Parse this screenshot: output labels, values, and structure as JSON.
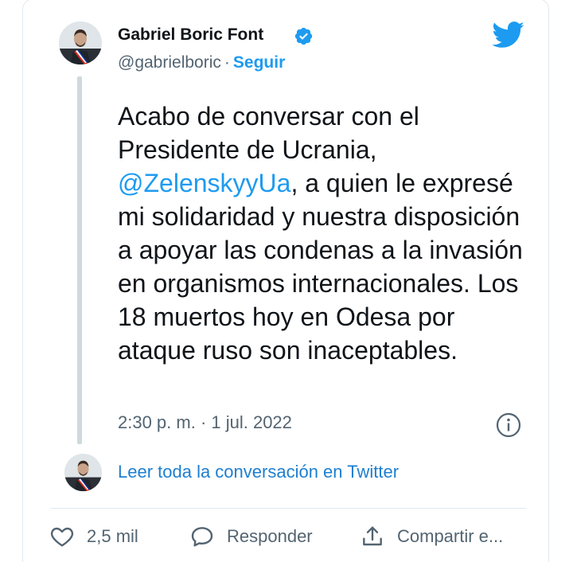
{
  "author": {
    "name": "Gabriel Boric Font",
    "handle": "@gabrielboric",
    "separator": "·",
    "follow_label": "Seguir"
  },
  "tweet": {
    "text_before_mention": "Acabo de conversar con el Presidente de Ucrania, ",
    "mention": "@ZelenskyyUa",
    "text_after_mention": ", a quien le expresé mi solidaridad y nuestra disposición a apoyar las condenas a la invasión en organismos internacionales. Los 18 muertos hoy en Odesa por ataque ruso son inaceptables.",
    "timestamp": "2:30 p. m. · 1 jul. 2022"
  },
  "conversation_link": "Leer toda la conversación en Twitter",
  "actions": {
    "like_count": "2,5 mil",
    "reply_label": "Responder",
    "share_label": "Compartir e..."
  },
  "icons": {
    "verified": "verified-badge-icon",
    "bird": "twitter-bird-icon",
    "info": "info-icon",
    "like": "heart-icon",
    "reply": "reply-bubble-icon",
    "share": "share-icon"
  },
  "colors": {
    "accent": "#1d9bf0",
    "text": "#0f1419",
    "secondary": "#536471",
    "border": "#e1e8ed"
  }
}
